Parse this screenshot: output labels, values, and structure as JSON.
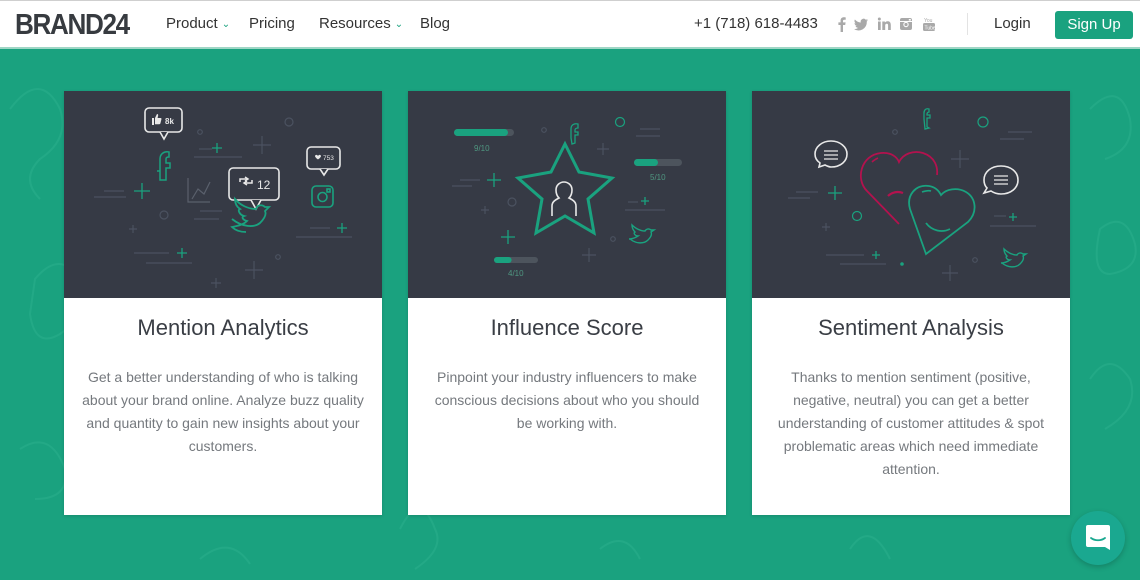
{
  "header": {
    "logo": "BRAND24",
    "nav": [
      {
        "label": "Product",
        "has_dropdown": true
      },
      {
        "label": "Pricing",
        "has_dropdown": false
      },
      {
        "label": "Resources",
        "has_dropdown": true
      },
      {
        "label": "Blog",
        "has_dropdown": false
      }
    ],
    "dropdown_icon": "chevron-down-icon",
    "phone": "+1 (718) 618-4483",
    "social_icons": [
      "facebook-icon",
      "twitter-icon",
      "linkedin-icon",
      "instagram-icon",
      "youtube-icon"
    ],
    "login_label": "Login",
    "signup_label": "Sign Up"
  },
  "colors": {
    "brand": "#1aa27f",
    "illustration_bg": "#363a45",
    "negative": "#b3124e"
  },
  "cards": [
    {
      "title": "Mention Analytics",
      "description": "Get a better understanding of who is talking about your brand online. Analyze buzz quality and quantity to gain new insights about your customers.",
      "illustration": {
        "likes_badge": "8k",
        "retweets_badge": "12",
        "hearts_badge": "753"
      }
    },
    {
      "title": "Influence Score",
      "description": "Pinpoint your industry influencers to make conscious decisions about who you should be working with.",
      "illustration": {
        "scores": [
          {
            "label": "9/10",
            "value": 0.9
          },
          {
            "label": "5/10",
            "value": 0.5
          },
          {
            "label": "4/10",
            "value": 0.4
          }
        ]
      }
    },
    {
      "title": "Sentiment Analysis",
      "description": "Thanks to mention sentiment (positive, negative, neutral) you can get a better understanding of customer attitudes & spot problematic areas which need immediate attention.",
      "illustration": {}
    }
  ],
  "chat_widget": {
    "icon": "chat-icon"
  }
}
